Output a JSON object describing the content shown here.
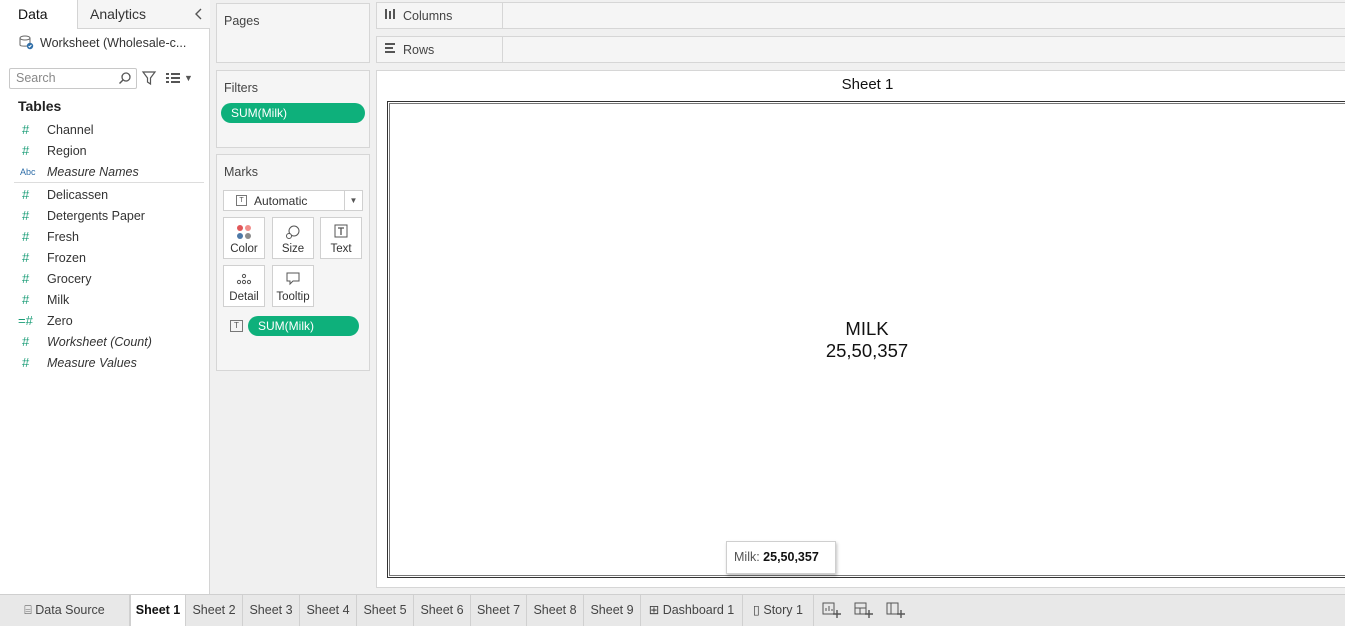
{
  "left_pane": {
    "tabs": [
      {
        "label": "Data"
      },
      {
        "label": "Analytics"
      }
    ],
    "datasource": "Worksheet (Wholesale-c...",
    "search_placeholder": "Search",
    "tables_heading": "Tables",
    "fields": [
      {
        "icon": "#",
        "label": "Channel",
        "style": "normal"
      },
      {
        "icon": "#",
        "label": "Region",
        "style": "normal"
      },
      {
        "icon": "Abc",
        "label": "Measure Names",
        "style": "italic"
      },
      {
        "icon": "#",
        "label": "Delicassen",
        "style": "normal"
      },
      {
        "icon": "#",
        "label": "Detergents Paper",
        "style": "normal"
      },
      {
        "icon": "#",
        "label": "Fresh",
        "style": "normal"
      },
      {
        "icon": "#",
        "label": "Frozen",
        "style": "normal"
      },
      {
        "icon": "#",
        "label": "Grocery",
        "style": "normal"
      },
      {
        "icon": "#",
        "label": "Milk",
        "style": "normal"
      },
      {
        "icon": "=#",
        "label": "Zero",
        "style": "normal"
      },
      {
        "icon": "#",
        "label": "Worksheet (Count)",
        "style": "italic"
      },
      {
        "icon": "#",
        "label": "Measure Values",
        "style": "italic"
      }
    ]
  },
  "cards": {
    "pages_title": "Pages",
    "filters_title": "Filters",
    "filter_pill": "SUM(Milk)",
    "marks_title": "Marks",
    "mark_type": "Automatic",
    "mark_buttons": {
      "color": "Color",
      "size": "Size",
      "text": "Text",
      "detail": "Detail",
      "tooltip": "Tooltip"
    },
    "mark_pill": "SUM(Milk)"
  },
  "shelves": {
    "columns": "Columns",
    "rows": "Rows"
  },
  "view": {
    "sheet_title": "Sheet 1",
    "mark_line1": "MILK",
    "mark_line2": "25,50,357",
    "tooltip_label": "Milk: ",
    "tooltip_value": "25,50,357"
  },
  "sheet_tabs": [
    {
      "label": "Data Source",
      "icon": "datasource-icon"
    },
    {
      "label": "Sheet 1",
      "active": true
    },
    {
      "label": "Sheet 2"
    },
    {
      "label": "Sheet 3"
    },
    {
      "label": "Sheet 4"
    },
    {
      "label": "Sheet 5"
    },
    {
      "label": "Sheet 6"
    },
    {
      "label": "Sheet 7"
    },
    {
      "label": "Sheet 8"
    },
    {
      "label": "Sheet 9"
    },
    {
      "label": "Dashboard 1",
      "icon": "dashboard-icon"
    },
    {
      "label": "Story 1",
      "icon": "story-icon"
    }
  ],
  "colors": {
    "accent_pill": "#0eb07b",
    "field_icon": "#1a9d77"
  }
}
